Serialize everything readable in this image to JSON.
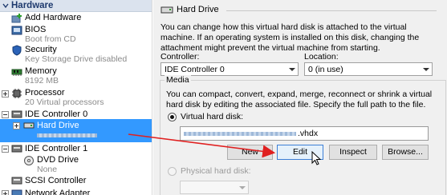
{
  "sidebar": {
    "header": "Hardware",
    "items": [
      {
        "label": "Add Hardware",
        "icon": "add-hardware-icon"
      },
      {
        "label": "BIOS",
        "sub": "Boot from CD",
        "icon": "bios-icon"
      },
      {
        "label": "Security",
        "sub": "Key Storage Drive disabled",
        "icon": "shield-icon"
      },
      {
        "label": "Memory",
        "sub": "8192 MB",
        "icon": "memory-icon"
      },
      {
        "label": "Processor",
        "sub": "20 Virtual processors",
        "icon": "processor-icon"
      },
      {
        "label": "IDE Controller 0",
        "icon": "ide-controller-icon"
      },
      {
        "label": "Hard Drive",
        "icon": "hard-drive-icon"
      },
      {
        "label": "IDE Controller 1",
        "icon": "ide-controller-icon"
      },
      {
        "label": "DVD Drive",
        "sub": "None",
        "icon": "dvd-drive-icon"
      },
      {
        "label": "SCSI Controller",
        "icon": "scsi-controller-icon"
      },
      {
        "label": "Network Adapter",
        "icon": "network-adapter-icon"
      }
    ]
  },
  "panel": {
    "title": "Hard Drive",
    "description": "You can change how this virtual hard disk is attached to the virtual machine. If an operating system is installed on this disk, changing the attachment might prevent the virtual machine from starting.",
    "controller_label": "Controller:",
    "controller_value": "IDE Controller 0",
    "location_label": "Location:",
    "location_value": "0 (in use)",
    "media_label": "Media",
    "media_description": "You can compact, convert, expand, merge, reconnect or shrink a virtual hard disk by editing the associated file. Specify the full path to the file.",
    "vhd_radio_label": "Virtual hard disk:",
    "vhd_path_suffix": ".vhdx",
    "buttons": {
      "new": "New",
      "edit": "Edit",
      "inspect": "Inspect",
      "browse": "Browse..."
    },
    "physical_radio_label": "Physical hard disk:"
  },
  "colors": {
    "selection": "#3399ff",
    "header_bg": "#dbe3ee",
    "arrow": "#e02020"
  }
}
